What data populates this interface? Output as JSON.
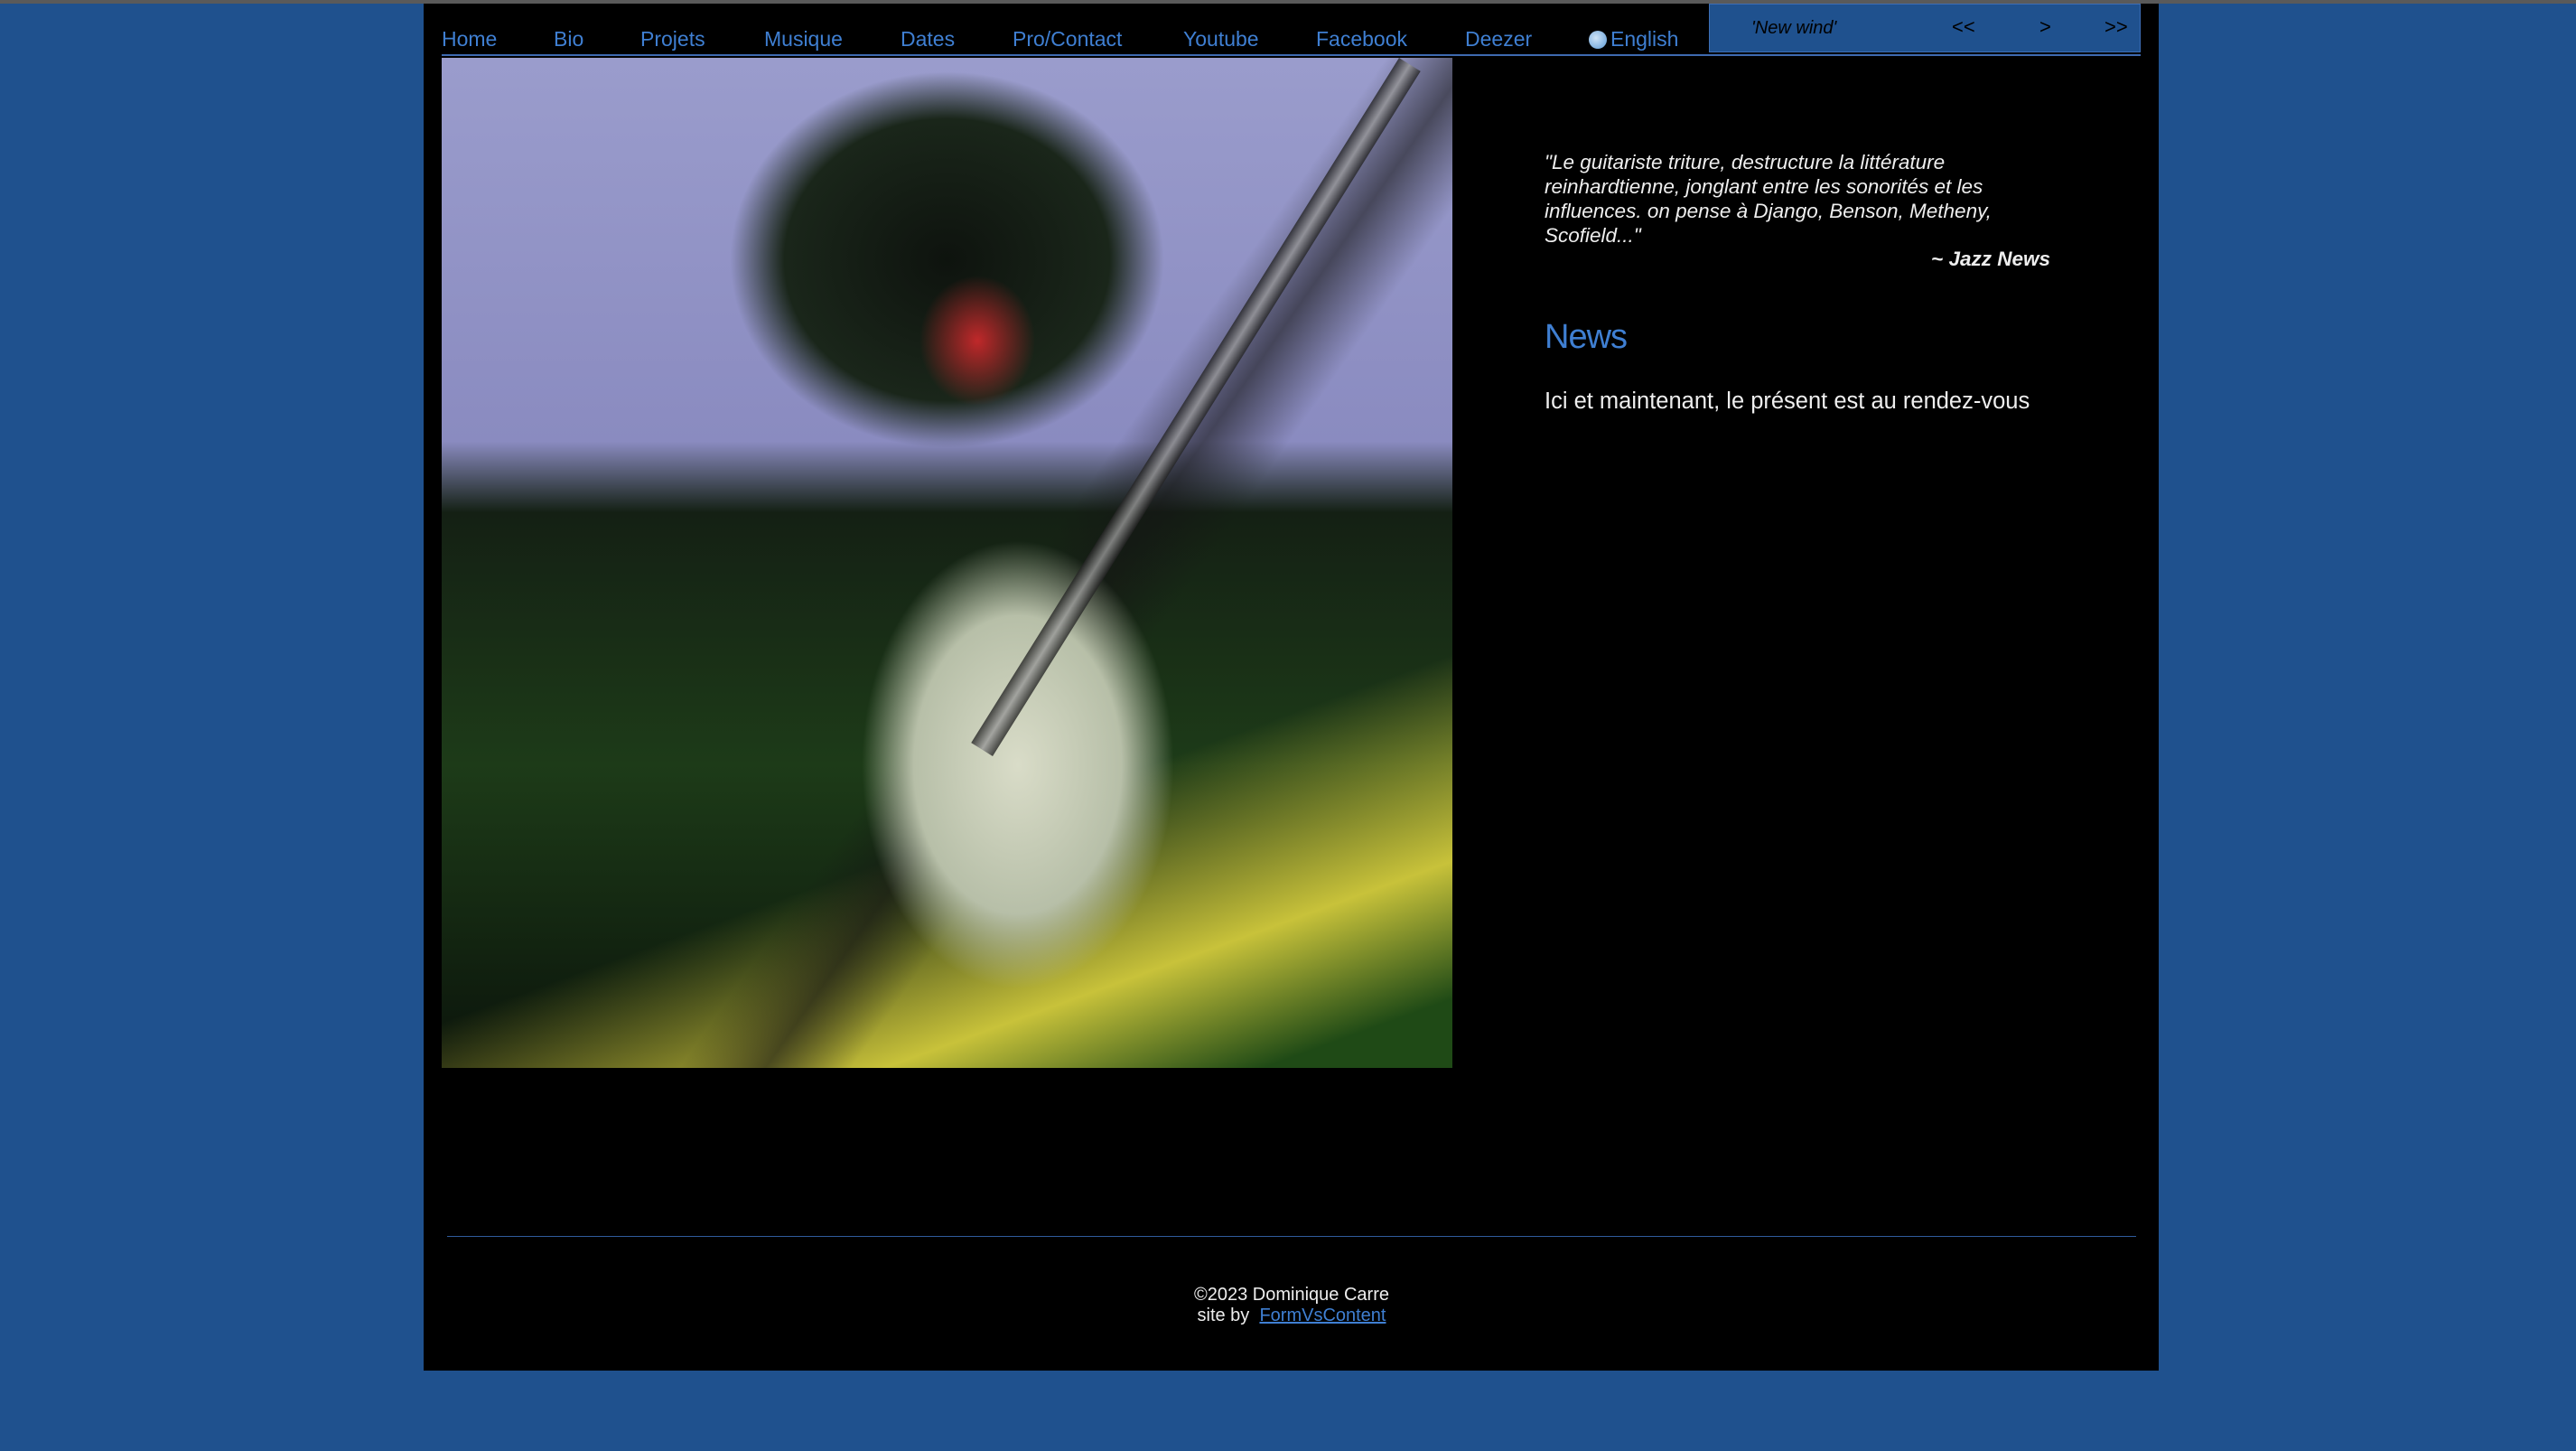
{
  "nav": {
    "items": [
      {
        "label": "Home"
      },
      {
        "label": "Bio"
      },
      {
        "label": "Projets"
      },
      {
        "label": "Musique"
      },
      {
        "label": "Dates"
      },
      {
        "label": "Pro/Contact"
      },
      {
        "label": "Youtube"
      },
      {
        "label": "Facebook"
      },
      {
        "label": "Deezer"
      }
    ],
    "language": "English",
    "language_icon": "globe-icon"
  },
  "player": {
    "track": "'New wind'",
    "first": "<<",
    "next": ">",
    "last": ">>"
  },
  "quote": {
    "text": "\"Le guitariste triture, destructure la littérature reinhardtienne, jonglant entre les sonorités et les influences. on pense à Django, Benson, Metheny, Scofield...\"",
    "source": "~ Jazz News"
  },
  "news": {
    "title": "News",
    "body": "Ici et maintenant, le présent est au rendez-vous"
  },
  "footer": {
    "copyright": "©2023 Dominique Carre",
    "site_by": "site by",
    "credit_link": "FormVsContent"
  },
  "colors": {
    "background": "#1f518e",
    "accent": "#3f7fd2",
    "content": "#000000"
  }
}
